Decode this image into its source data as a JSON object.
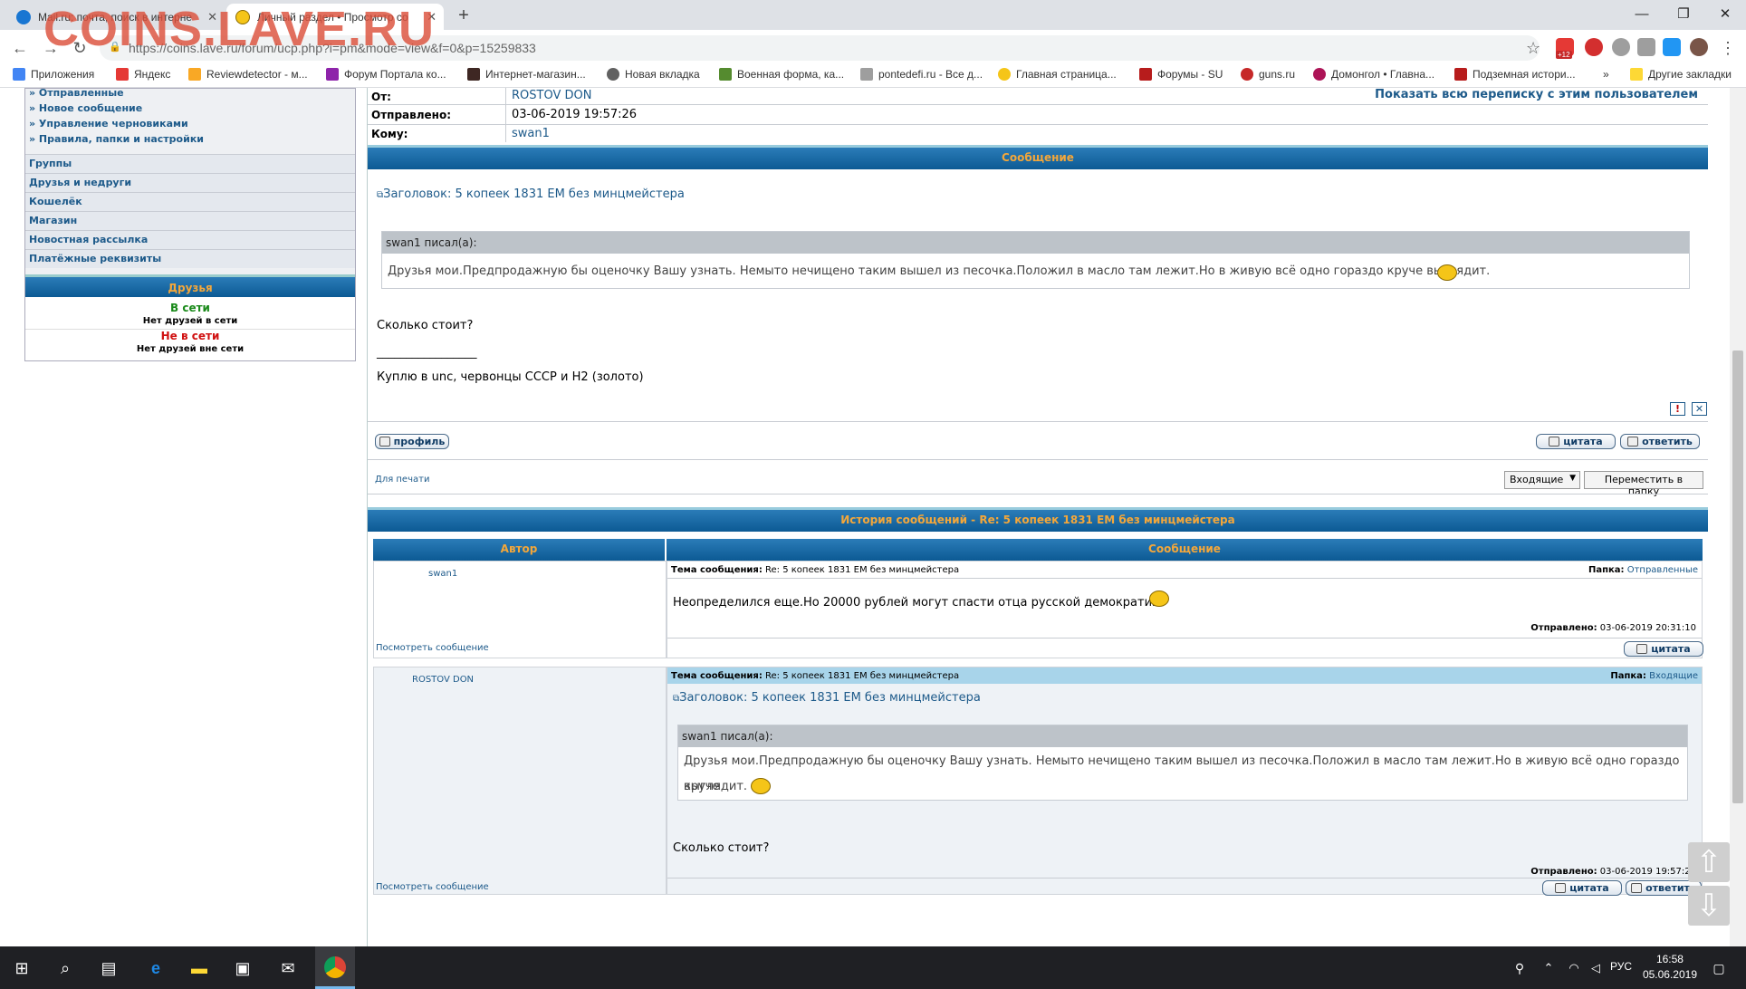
{
  "watermark": "COINS.LAVE.RU",
  "browser": {
    "tabs": [
      {
        "title": "Mail.ru: почта, поиск в интерне",
        "close": "✕"
      },
      {
        "title": "Личный раздел • Просмотр со",
        "close": "✕"
      }
    ],
    "new_tab": "+",
    "url": "https://coins.lave.ru/forum/ucp.php?i=pm&mode=view&f=0&p=15259833",
    "bookmarks": [
      "Приложения",
      "Яндекс",
      "Reviewdetector - м...",
      "Форум Портала ко...",
      "Интернет-магазин...",
      "Новая вкладка",
      "Военная форма, ка...",
      "pontedefi.ru - Все д...",
      "Главная страница...",
      "Форумы - SU",
      "guns.ru",
      "Домонгол • Главна...",
      "Подземная истори...",
      "Другие закладки"
    ],
    "bookmarks_more": "»",
    "extension_badge": "+12",
    "win": {
      "min": "—",
      "max": "❐",
      "close": "✕"
    },
    "nav": {
      "back": "←",
      "forward": "→",
      "reload": "↻",
      "lock": "🔒",
      "star": "☆",
      "menu": "⋮"
    }
  },
  "sidebar": {
    "links": [
      "» Отправленные",
      "» Новое сообщение",
      "» Управление черновиками",
      "» Правила, папки и настройки"
    ],
    "sections": [
      "Группы",
      "Друзья и недруги",
      "Кошелёк",
      "Магазин",
      "Новостная рассылка",
      "Платёжные реквизиты"
    ],
    "friends": {
      "title": "Друзья",
      "online": "В сети",
      "online_none": "Нет друзей в сети",
      "offline": "Не в сети",
      "offline_none": "Нет друзей вне сети"
    }
  },
  "message": {
    "from_label": "От:",
    "from_value": "ROSTOV DON",
    "show_all": "Показать всю переписку с этим пользователем",
    "sent_label": "Отправлено:",
    "sent_value": "03-06-2019 19:57:26",
    "to_label": "Кому:",
    "to_value": "swan1",
    "section_title": "Сообщение",
    "subject": "Заголовок: 5 копеек 1831 ЕМ без минцмейстера",
    "quote_author": "swan1 писал(а):",
    "quote_text": "Друзья мои.Предпродажную бы оценочку Вашу узнать. Немыто нечищено таким вышел из песочка.Положил в масло там лежит.Но в живую всё одно гораздо круче выглядит.",
    "body": "Сколько стоит?",
    "signature_line": "_________________",
    "signature": "Куплю в unc, червонцы СССР и Н2 (золото)",
    "report_icon": "!",
    "delete_icon": "✕",
    "profile_button": "профиль",
    "quote_button": "цитата",
    "reply_button": "ответить",
    "print_link": "Для печати",
    "folder_select": "Входящие",
    "move_button": "Переместить в папку"
  },
  "history": {
    "title": "История сообщений - Re: 5 копеек 1831 ЕМ без минцмейстера",
    "col_author": "Автор",
    "col_message": "Сообщение",
    "topic_label": "Тема сообщения:",
    "folder_label": "Папка:",
    "sent_label": "Отправлено:",
    "view_link": "Посмотреть сообщение",
    "entries": [
      {
        "author": "swan1",
        "topic": "Re: 5 копеек 1831 ЕМ без минцмейстера",
        "folder": "Отправленные",
        "text": "Неопределился еще.Но 20000 рублей могут спасти отца русской демократии.",
        "sent": "03-06-2019 20:31:10",
        "quote_button": "цитата"
      },
      {
        "author": "ROSTOV DON",
        "topic": "Re: 5 копеек 1831 ЕМ без минцмейстера",
        "folder": "Входящие",
        "subject": "Заголовок: 5 копеек 1831 ЕМ без минцмейстера",
        "quote_author": "swan1 писал(а):",
        "quote_text_1": "Друзья мои.Предпродажную бы оценочку Вашу узнать. Немыто нечищено таким вышел из песочка.Положил в масло там лежит.Но в живую всё одно гораздо круче",
        "quote_text_2": "выглядит.",
        "text": "Сколько стоит?",
        "sent": "03-06-2019 19:57:26",
        "quote_button": "цитата",
        "reply_button": "ответить"
      }
    ]
  },
  "taskbar": {
    "lang": "РУС",
    "time": "16:58",
    "date": "05.06.2019"
  },
  "scroll_buttons": {
    "up": "⇧",
    "down": "⇩"
  }
}
